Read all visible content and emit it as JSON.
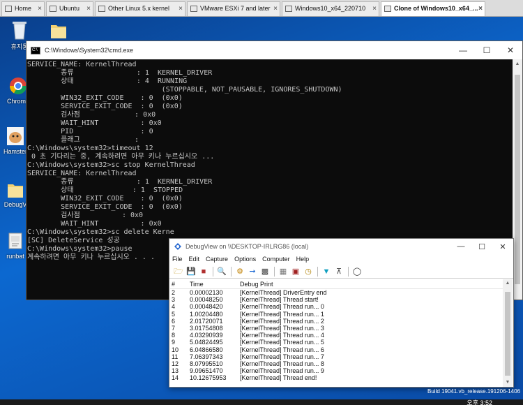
{
  "tabs": [
    {
      "label": "Home"
    },
    {
      "label": "Ubuntu"
    },
    {
      "label": "Other Linux 5.x kernel"
    },
    {
      "label": "VMware ESXi 7 and later"
    },
    {
      "label": "Windows10_x64_220710"
    },
    {
      "label": "Clone of Windows10_x64_..."
    }
  ],
  "desktop": {
    "icons": [
      {
        "label": "휴지통"
      },
      {
        "label": ""
      },
      {
        "label": "Chrome"
      },
      {
        "label": "Hamster"
      },
      {
        "label": "DebugV"
      },
      {
        "label": "runbat"
      }
    ]
  },
  "cmd": {
    "title": "C:\\Windows\\System32\\cmd.exe",
    "lines": [
      "SERVICE_NAME: KernelThread",
      "        종류               : 1  KERNEL_DRIVER",
      "        상태               : 4  RUNNING",
      "                                (STOPPABLE, NOT_PAUSABLE, IGNORES_SHUTDOWN)",
      "        WIN32_EXIT_CODE    : 0  (0x0)",
      "        SERVICE_EXIT_CODE  : 0  (0x0)",
      "        검사점             : 0x0",
      "        WAIT_HINT          : 0x0",
      "        PID                : 0",
      "        플래그             :",
      "",
      "C:\\Windows\\system32>timeout 12",
      "",
      " 0 초 기다리는 중, 계속하려면 아무 키나 누르십시오 ...",
      "",
      "C:\\Windows\\system32>sc stop KernelThread",
      "",
      "SERVICE_NAME: KernelThread",
      "        종류               : 1  KERNEL_DRIVER",
      "        상태              : 1  STOPPED",
      "        WIN32_EXIT_CODE    : 0  (0x0)",
      "        SERVICE_EXIT_CODE  : 0  (0x0)",
      "        검사점          : 0x0",
      "        WAIT_HINT          : 0x0",
      "",
      "C:\\Windows\\system32>sc delete Kerne",
      "[SC] DeleteService 성공",
      "",
      "C:\\Windows\\system32>pause",
      "계속하려면 아무 키나 누르십시오 . . ."
    ]
  },
  "debugview": {
    "title": "DebugView on \\\\DESKTOP-IRLRG86 (local)",
    "menu": [
      "File",
      "Edit",
      "Capture",
      "Options",
      "Computer",
      "Help"
    ],
    "columns": {
      "num": "#",
      "time": "Time",
      "msg": "Debug Print"
    },
    "rows": [
      {
        "num": "2",
        "time": "0.00002130",
        "msg": "[KernelThread] DriverEntry end"
      },
      {
        "num": "3",
        "time": "0.00048250",
        "msg": "[KernelThread] Thread start!"
      },
      {
        "num": "4",
        "time": "0.00048420",
        "msg": "[KernelThread] Thread run... 0"
      },
      {
        "num": "5",
        "time": "1.00204480",
        "msg": "[KernelThread] Thread run... 1"
      },
      {
        "num": "6",
        "time": "2.01720071",
        "msg": "[KernelThread] Thread run... 2"
      },
      {
        "num": "7",
        "time": "3.01754808",
        "msg": "[KernelThread] Thread run... 3"
      },
      {
        "num": "8",
        "time": "4.03290939",
        "msg": "[KernelThread] Thread run... 4"
      },
      {
        "num": "9",
        "time": "5.04824495",
        "msg": "[KernelThread] Thread run... 5"
      },
      {
        "num": "10",
        "time": "6.04866580",
        "msg": "[KernelThread] Thread run... 6"
      },
      {
        "num": "11",
        "time": "7.06397343",
        "msg": "[KernelThread] Thread run... 7"
      },
      {
        "num": "12",
        "time": "8.07995510",
        "msg": "[KernelThread] Thread run... 8"
      },
      {
        "num": "13",
        "time": "9.09651470",
        "msg": "[KernelThread] Thread run... 9"
      },
      {
        "num": "14",
        "time": "10.12675953",
        "msg": "[KernelThread] Thread end!"
      }
    ]
  },
  "system": {
    "build": "Build 19041.vb_release.191206-1406",
    "clock": "오후 3:52"
  },
  "colors": {
    "desktop": "#0b5bb8",
    "console_bg": "#0c0c0c",
    "console_fg": "#c8c8c8"
  }
}
